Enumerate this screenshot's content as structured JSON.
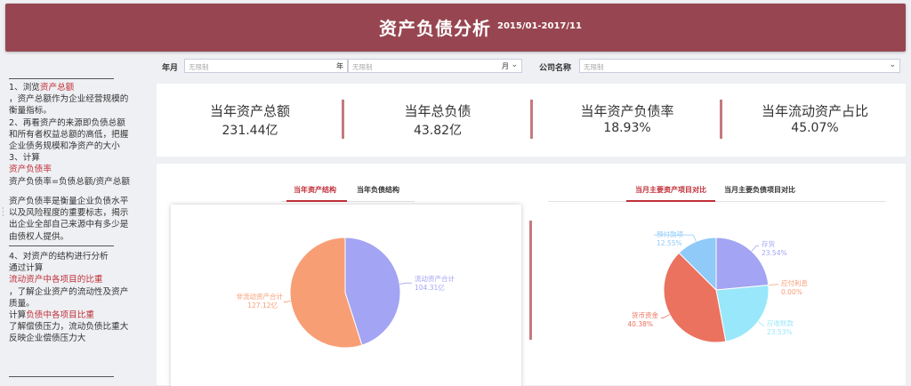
{
  "header": {
    "title": "资产负债分析",
    "date_range": "2015/01-2017/11"
  },
  "sidebar": {
    "s1": [
      "1、浏览",
      "资产总额"
    ],
    "s1_text": [
      "，资产总额作为企业经营规模的",
      "衡量指标。",
      "2、再看资产的来源即负债总额",
      "和所有者权益总额的高低，把握",
      "企业债务规模和净资产的大小",
      "3、计算"
    ],
    "s1_red": "资产负债率",
    "s1_formula": "资产负债率=负债总额/资产总额",
    "s2_text": [
      "资产负债率是衡量企业负债水平",
      "以及风险程度的重要标志，揭示",
      "出企业全部自己来源中有多少是",
      "由债权人提供。"
    ],
    "s3_lines": [
      "4、对资产的结构进行分析",
      "通过计算"
    ],
    "s3_red1": "流动资产中各项目的比重",
    "s3_mid": [
      "，了解企业资产的流动性及资产",
      "质量。"
    ],
    "s3_calc": "计算",
    "s3_red2": "负债中各项目比重",
    "s3_end": [
      "了解偿债压力，流动负债比重大",
      "反映企业偿债压力大"
    ]
  },
  "filters": {
    "year_month_label": "年月",
    "placeholder": "无限制",
    "year_suffix": "年",
    "month_suffix": "月",
    "company_label": "公司名称"
  },
  "kpis": [
    {
      "label": "当年资产总额",
      "value": "231.44亿"
    },
    {
      "label": "当年总负债",
      "value": "43.82亿"
    },
    {
      "label": "当年资产负债率",
      "value": "18.93%"
    },
    {
      "label": "当年流动资产占比",
      "value": "45.07%"
    }
  ],
  "left_tabs": [
    "当年资产结构",
    "当年负债结构"
  ],
  "right_tabs": [
    "当月主要资产项目对比",
    "当月主要负债项目对比"
  ],
  "colors": {
    "banner": "#974651",
    "accent_red": "#c0303a",
    "separator": "#c47a80"
  },
  "chart_data": [
    {
      "type": "pie",
      "slices": [
        {
          "name": "流动资产合计",
          "value": 104.31,
          "label": "104.31亿",
          "color": "#a3a4f3"
        },
        {
          "name": "非流动资产合计",
          "value": 127.12,
          "label": "127.12亿",
          "color": "#f89e75"
        }
      ]
    },
    {
      "type": "pie",
      "slices": [
        {
          "name": "存货",
          "value": 23.54,
          "label": "23.54%",
          "color": "#a3a4f3"
        },
        {
          "name": "应付利息",
          "value": 0.0,
          "label": "0.00%",
          "color": "#f89e75"
        },
        {
          "name": "应收账款",
          "value": 23.53,
          "label": "23.53%",
          "color": "#99e7fb"
        },
        {
          "name": "货币资金",
          "value": 40.38,
          "label": "40.38%",
          "color": "#ea725f"
        },
        {
          "name": "预付款项",
          "value": 12.55,
          "label": "12.55%",
          "color": "#8fcaf8"
        }
      ]
    }
  ]
}
